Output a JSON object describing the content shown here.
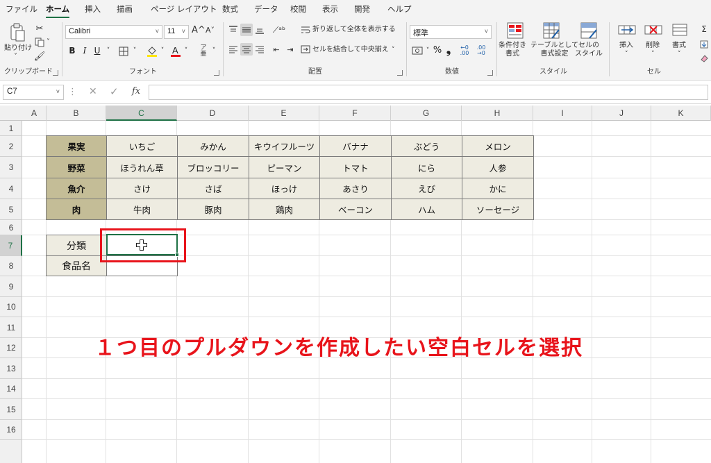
{
  "ribbon": {
    "tabs": [
      "ファイル",
      "ホーム",
      "挿入",
      "描画",
      "ページ レイアウト",
      "数式",
      "データ",
      "校閲",
      "表示",
      "開発",
      "ヘルプ"
    ],
    "active_tab": "ホーム",
    "clipboard": {
      "paste_label": "貼り付け",
      "group_label": "クリップボード"
    },
    "font": {
      "name": "Calibri",
      "size": "11",
      "group_label": "フォント",
      "grow": "A^",
      "shrink": "A˅"
    },
    "alignment": {
      "wrap_label": "折り返して全体を表示する",
      "merge_label": "セルを結合して中央揃え",
      "group_label": "配置"
    },
    "number": {
      "format": "標準",
      "group_label": "数値"
    },
    "styles": {
      "conditional": "条件付き\n書式",
      "table": "テーブルとして\n書式設定",
      "cell_styles": "セルの\nスタイル",
      "group_label": "スタイル"
    },
    "cells": {
      "insert": "挿入",
      "delete": "削除",
      "format": "書式",
      "group_label": "セル"
    }
  },
  "formula_bar": {
    "name_box": "C7",
    "fx": "fx",
    "content": ""
  },
  "sheet": {
    "columns": [
      "A",
      "B",
      "C",
      "D",
      "E",
      "F",
      "G",
      "H",
      "I",
      "J",
      "K"
    ],
    "selected_column": "C",
    "rows": [
      "1",
      "2",
      "3",
      "4",
      "5",
      "6",
      "7",
      "8",
      "9",
      "10",
      "11",
      "12",
      "13",
      "14",
      "15",
      "16"
    ],
    "selected_row": "7",
    "table": [
      {
        "category": "果実",
        "items": [
          "いちご",
          "みかん",
          "キウイフルーツ",
          "バナナ",
          "ぶどう",
          "メロン"
        ]
      },
      {
        "category": "野菜",
        "items": [
          "ほうれん草",
          "ブロッコリー",
          "ピーマン",
          "トマト",
          "にら",
          "人参"
        ]
      },
      {
        "category": "魚介",
        "items": [
          "さけ",
          "さば",
          "ほっけ",
          "あさり",
          "えび",
          "かに"
        ]
      },
      {
        "category": "肉",
        "items": [
          "牛肉",
          "豚肉",
          "鶏肉",
          "ベーコン",
          "ハム",
          "ソーセージ"
        ]
      }
    ],
    "input_labels": {
      "category": "分類",
      "food_name": "食品名"
    },
    "selected_cell": "C7"
  },
  "annotation": "１つ目のプルダウンを作成したい空白セルを選択",
  "colors": {
    "accent": "#1e7145",
    "annotation_red": "#e8141b",
    "category_fill": "#c4bd97",
    "value_fill": "#eeece1"
  }
}
